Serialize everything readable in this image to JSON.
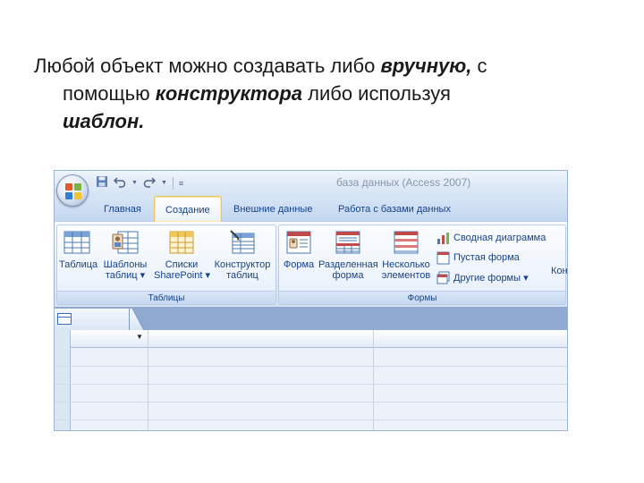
{
  "caption": {
    "line1_pre": "Любой объект можно создавать либо ",
    "line1_em": "вручную,",
    "line1_post": " с",
    "line2_pre": "помощью ",
    "line2_em": "конструктора",
    "line2_post": " либо  используя",
    "line3_em": "шаблон."
  },
  "window": {
    "title": "база данных (Access 2007)",
    "qat": {
      "save_icon": "save-icon",
      "undo_icon": "undo-icon",
      "redo_icon": "redo-icon",
      "customize_icon": "chevron-down-icon"
    }
  },
  "ribbon": {
    "tabs": [
      {
        "label": "Главная",
        "active": false
      },
      {
        "label": "Создание",
        "active": true
      },
      {
        "label": "Внешние данные",
        "active": false
      },
      {
        "label": "Работа с базами данных",
        "active": false
      }
    ],
    "groups": {
      "tables": {
        "label": "Таблицы",
        "buttons": [
          {
            "line1": "Таблица",
            "line2": "",
            "icon": "table-icon"
          },
          {
            "line1": "Шаблоны",
            "line2": "таблиц ▾",
            "icon": "table-templates-icon"
          },
          {
            "line1": "Списки",
            "line2": "SharePoint ▾",
            "icon": "sharepoint-lists-icon"
          },
          {
            "line1": "Конструктор",
            "line2": "таблиц",
            "icon": "table-design-icon"
          }
        ]
      },
      "forms": {
        "label": "Формы",
        "buttons": [
          {
            "line1": "Форма",
            "line2": "",
            "icon": "form-icon"
          },
          {
            "line1": "Разделенная",
            "line2": "форма",
            "icon": "split-form-icon"
          },
          {
            "line1": "Несколько",
            "line2": "элементов",
            "icon": "multiple-items-icon"
          }
        ],
        "small_buttons": [
          {
            "label": "Сводная диаграмма",
            "icon": "pivot-chart-icon"
          },
          {
            "label": "Пустая форма",
            "icon": "blank-form-icon"
          },
          {
            "label": "Другие формы ▾",
            "icon": "more-forms-icon"
          }
        ],
        "cut_label": "Кон"
      }
    }
  },
  "colors": {
    "ribbon_text": "#15428b",
    "active_tab_border": "#f2c25a",
    "doc_strip": "#8fa9d1"
  }
}
